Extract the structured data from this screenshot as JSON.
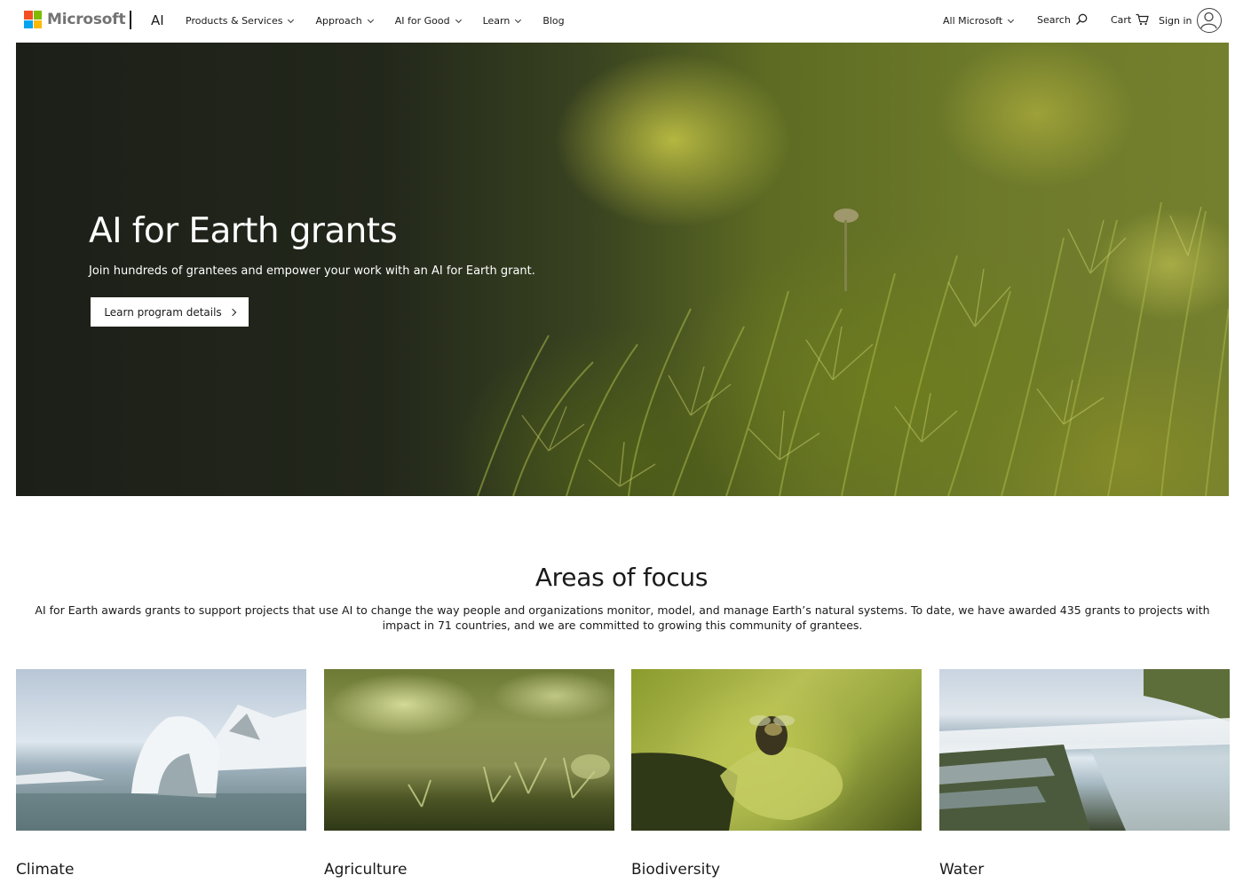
{
  "header": {
    "brand": "Microsoft",
    "section": "AI",
    "nav": [
      {
        "label": "Products & Services"
      },
      {
        "label": "Approach"
      },
      {
        "label": "AI for Good"
      },
      {
        "label": "Learn"
      },
      {
        "label": "Blog"
      }
    ],
    "all_microsoft": "All Microsoft",
    "search": "Search",
    "cart": "Cart",
    "sign_in": "Sign in"
  },
  "hero": {
    "title": "AI for Earth grants",
    "subtitle": "Join hundreds of grantees and empower your work with an AI for Earth grant.",
    "button": "Learn program details"
  },
  "focus": {
    "title": "Areas of focus",
    "description": "AI for Earth awards grants to support projects that use AI to change the way people and organizations monitor, model, and manage Earth’s natural systems. To date, we have awarded 435 grants to projects with impact in 71 countries, and we are committed to growing this community of grantees.",
    "cards": [
      {
        "label": "Climate"
      },
      {
        "label": "Agriculture"
      },
      {
        "label": "Biodiversity"
      },
      {
        "label": "Water"
      }
    ]
  },
  "colors": {
    "ms_red": "#f25022",
    "ms_green": "#7fba00",
    "ms_blue": "#00a4ef",
    "ms_yellow": "#ffb900"
  }
}
